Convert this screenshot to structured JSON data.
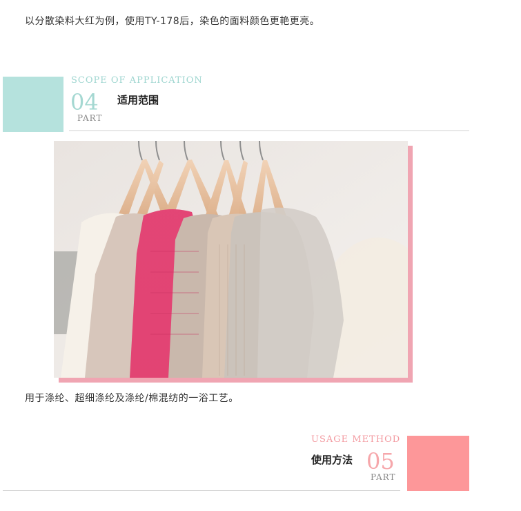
{
  "intro_paragraph": "以分散染料大红为例，使用TY-178后，染色的面料颜色更艳更亮。",
  "section4": {
    "english_title": "SCOPE OF APPLICATION",
    "number": "04",
    "part_label": "PART",
    "chinese_title": "适用范围",
    "accent_color": "#b5e2dd"
  },
  "photo": {
    "subject": "sweaters-on-hangers-photo",
    "frame_color": "#f0a5b2"
  },
  "scope_paragraph": "用于涤纶、超细涤纶及涤纶/棉混纺的一浴工艺。",
  "section5": {
    "english_title": "USAGE METHOD",
    "number": "05",
    "part_label": "PART",
    "chinese_title": "使用方法",
    "accent_color": "#fd9799"
  }
}
